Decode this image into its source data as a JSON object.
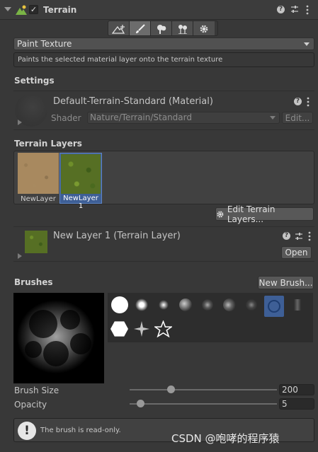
{
  "header": {
    "title": "Terrain",
    "enabled": true
  },
  "toolbar": {
    "tools": [
      "raise-lower-terrain",
      "paint-texture",
      "paint-trees",
      "paint-details",
      "terrain-settings"
    ],
    "active_index": 1
  },
  "tool_select": {
    "value": "Paint Texture"
  },
  "tool_description": "Paints the selected material layer onto the terrain texture",
  "settings": {
    "heading": "Settings",
    "material_name": "Default-Terrain-Standard (Material)",
    "shader_label": "Shader",
    "shader_value": "Nature/Terrain/Standard",
    "edit_label": "Edit..."
  },
  "terrain_layers": {
    "heading": "Terrain Layers",
    "layers": [
      {
        "label": "NewLayer",
        "selected": false
      },
      {
        "label": "NewLayer 1",
        "selected": true
      }
    ],
    "edit_button": "Edit Terrain Layers..."
  },
  "layer_inspector": {
    "title": "New Layer 1 (Terrain Layer)",
    "open_button": "Open"
  },
  "brushes": {
    "heading": "Brushes",
    "new_button": "New Brush...",
    "selected_index": 8
  },
  "brush_size": {
    "label": "Brush Size",
    "value": "200",
    "fraction": 0.27
  },
  "opacity": {
    "label": "Opacity",
    "value": "5",
    "fraction": 0.05
  },
  "help": {
    "text": "The brush is read-only."
  },
  "watermark": "CSDN @咆哮的程序猿",
  "colors": {
    "background": "#383838",
    "selection": "#3e5f96",
    "field": "#2a2a2a",
    "button": "#585858"
  }
}
